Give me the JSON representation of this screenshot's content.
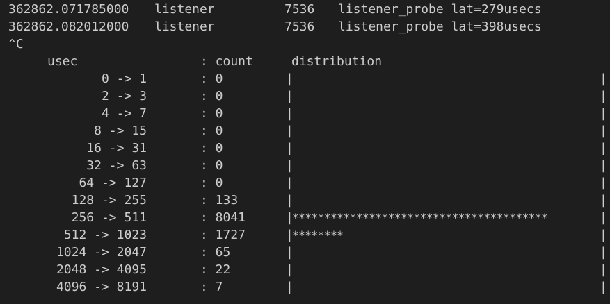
{
  "trace_lines": [
    {
      "timestamp": "362862.071785000",
      "comm": "listener",
      "pid": "7536",
      "message": "listener_probe lat=279usecs"
    },
    {
      "timestamp": "362862.082012000",
      "comm": "listener",
      "pid": "7536",
      "message": "listener_probe lat=398usecs"
    }
  ],
  "interrupt": "^C",
  "histogram": {
    "header": {
      "unit": "usec",
      "count": ": count",
      "distribution": "distribution"
    },
    "bar_edge": "|",
    "rows": [
      {
        "range": "0 -> 1",
        "count": ": 0",
        "bar": ""
      },
      {
        "range": "2 -> 3",
        "count": ": 0",
        "bar": ""
      },
      {
        "range": "4 -> 7",
        "count": ": 0",
        "bar": ""
      },
      {
        "range": "8 -> 15",
        "count": ": 0",
        "bar": ""
      },
      {
        "range": "16 -> 31",
        "count": ": 0",
        "bar": ""
      },
      {
        "range": "32 -> 63",
        "count": ": 0",
        "bar": ""
      },
      {
        "range": "64 -> 127",
        "count": ": 0",
        "bar": ""
      },
      {
        "range": "128 -> 255",
        "count": ": 133",
        "bar": ""
      },
      {
        "range": "256 -> 511",
        "count": ": 8041",
        "bar": "****************************************"
      },
      {
        "range": "512 -> 1023",
        "count": ": 1727",
        "bar": "********"
      },
      {
        "range": "1024 -> 2047",
        "count": ": 65",
        "bar": ""
      },
      {
        "range": "2048 -> 4095",
        "count": ": 22",
        "bar": ""
      },
      {
        "range": "4096 -> 8191",
        "count": ": 7",
        "bar": ""
      }
    ]
  },
  "colors": {
    "background": "#1e1e1e",
    "foreground": "#cccccc"
  }
}
